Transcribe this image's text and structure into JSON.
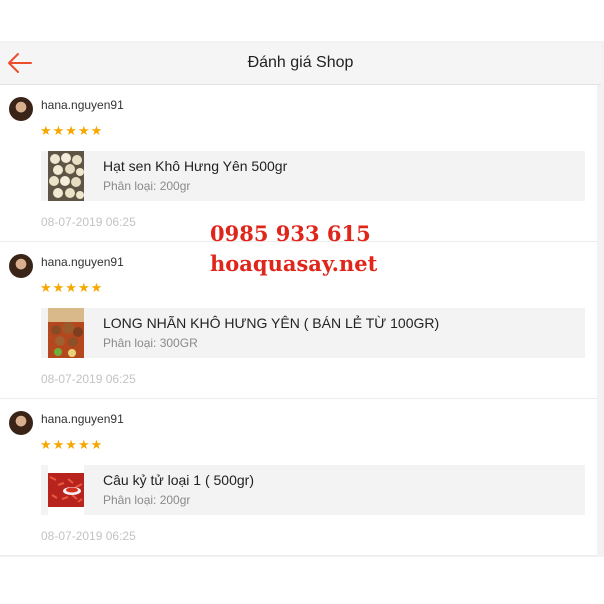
{
  "header": {
    "title": "Đánh giá Shop",
    "back_icon": "arrow-left-icon",
    "accent_color": "#ee4d2d"
  },
  "reviews": [
    {
      "username": "hana.nguyen91",
      "stars": "★★★★★",
      "rating": 5,
      "product_name": "Hạt sen Khô Hưng Yên 500gr",
      "variant": "Phân loại: 200gr",
      "date": "08-07-2019 06:25"
    },
    {
      "username": "hana.nguyen91",
      "stars": "★★★★★",
      "rating": 5,
      "product_name": "LONG NHÃN KHÔ HƯNG YÊN ( BÁN LẺ TỪ 100GR)",
      "variant": "Phân loại: 300GR",
      "date": "08-07-2019 06:25"
    },
    {
      "username": "hana.nguyen91",
      "stars": "★★★★★",
      "rating": 5,
      "product_name": "Câu kỷ tử loại 1 ( 500gr)",
      "variant": "Phân loại: 200gr",
      "date": "08-07-2019 06:25"
    }
  ],
  "watermark": {
    "phone": "0985 933 615",
    "site": "hoaquasay.net",
    "color": "#e0251b"
  },
  "colors": {
    "star": "#f6a700",
    "date": "#c3c3c3"
  }
}
